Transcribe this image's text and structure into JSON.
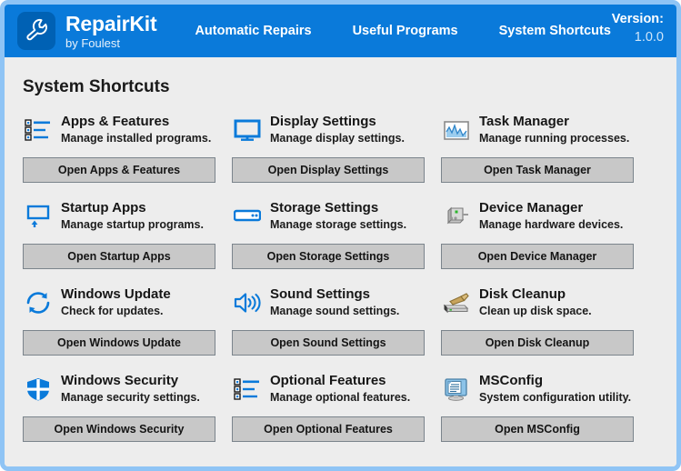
{
  "window": {
    "border_color": "#8fc4f5",
    "background": "#ededed"
  },
  "header": {
    "background": "#0a7ada",
    "logo_icon": "wrench-icon",
    "logo_background": "#0061b4",
    "brand_title": "RepairKit",
    "brand_subtitle": "by Foulest",
    "nav": [
      {
        "label": "Automatic Repairs",
        "name": "nav-automatic-repairs"
      },
      {
        "label": "Useful Programs",
        "name": "nav-useful-programs"
      },
      {
        "label": "System Shortcuts",
        "name": "nav-system-shortcuts"
      }
    ],
    "version_label": "Version:",
    "version_value": "1.0.0"
  },
  "main": {
    "page_title": "System Shortcuts",
    "accent_color": "#0a7ada",
    "button_color": "#c8c8c8",
    "cards": [
      {
        "name": "apps-and-features",
        "icon": "list-icon",
        "title": "Apps & Features",
        "description": "Manage installed programs.",
        "button_label": "Open Apps & Features"
      },
      {
        "name": "display-settings",
        "icon": "monitor-icon",
        "title": "Display Settings",
        "description": "Manage display settings.",
        "button_label": "Open Display Settings"
      },
      {
        "name": "task-manager",
        "icon": "chart-graph-icon",
        "title": "Task Manager",
        "description": "Manage running processes.",
        "button_label": "Open Task Manager"
      },
      {
        "name": "startup-apps",
        "icon": "window-up-arrow-icon",
        "title": "Startup Apps",
        "description": "Manage startup programs.",
        "button_label": "Open Startup Apps"
      },
      {
        "name": "storage-settings",
        "icon": "drive-icon",
        "title": "Storage Settings",
        "description": "Manage storage settings.",
        "button_label": "Open Storage Settings"
      },
      {
        "name": "device-manager",
        "icon": "hardware-device-icon",
        "title": "Device Manager",
        "description": "Manage hardware devices.",
        "button_label": "Open Device Manager"
      },
      {
        "name": "windows-update",
        "icon": "refresh-arrows-icon",
        "title": "Windows Update",
        "description": "Check for updates.",
        "button_label": "Open Windows Update"
      },
      {
        "name": "sound-settings",
        "icon": "speaker-icon",
        "title": "Sound Settings",
        "description": "Manage sound settings.",
        "button_label": "Open Sound Settings"
      },
      {
        "name": "disk-cleanup",
        "icon": "broom-disk-icon",
        "title": "Disk Cleanup",
        "description": "Clean up disk space.",
        "button_label": "Open Disk Cleanup"
      },
      {
        "name": "windows-security",
        "icon": "shield-icon",
        "title": "Windows Security",
        "description": "Manage security settings.",
        "button_label": "Open Windows Security"
      },
      {
        "name": "optional-features",
        "icon": "list-icon",
        "title": "Optional Features",
        "description": "Manage optional features.",
        "button_label": "Open Optional Features"
      },
      {
        "name": "msconfig",
        "icon": "monitor-document-icon",
        "title": "MSConfig",
        "description": "System configuration utility.",
        "button_label": "Open MSConfig"
      }
    ]
  }
}
